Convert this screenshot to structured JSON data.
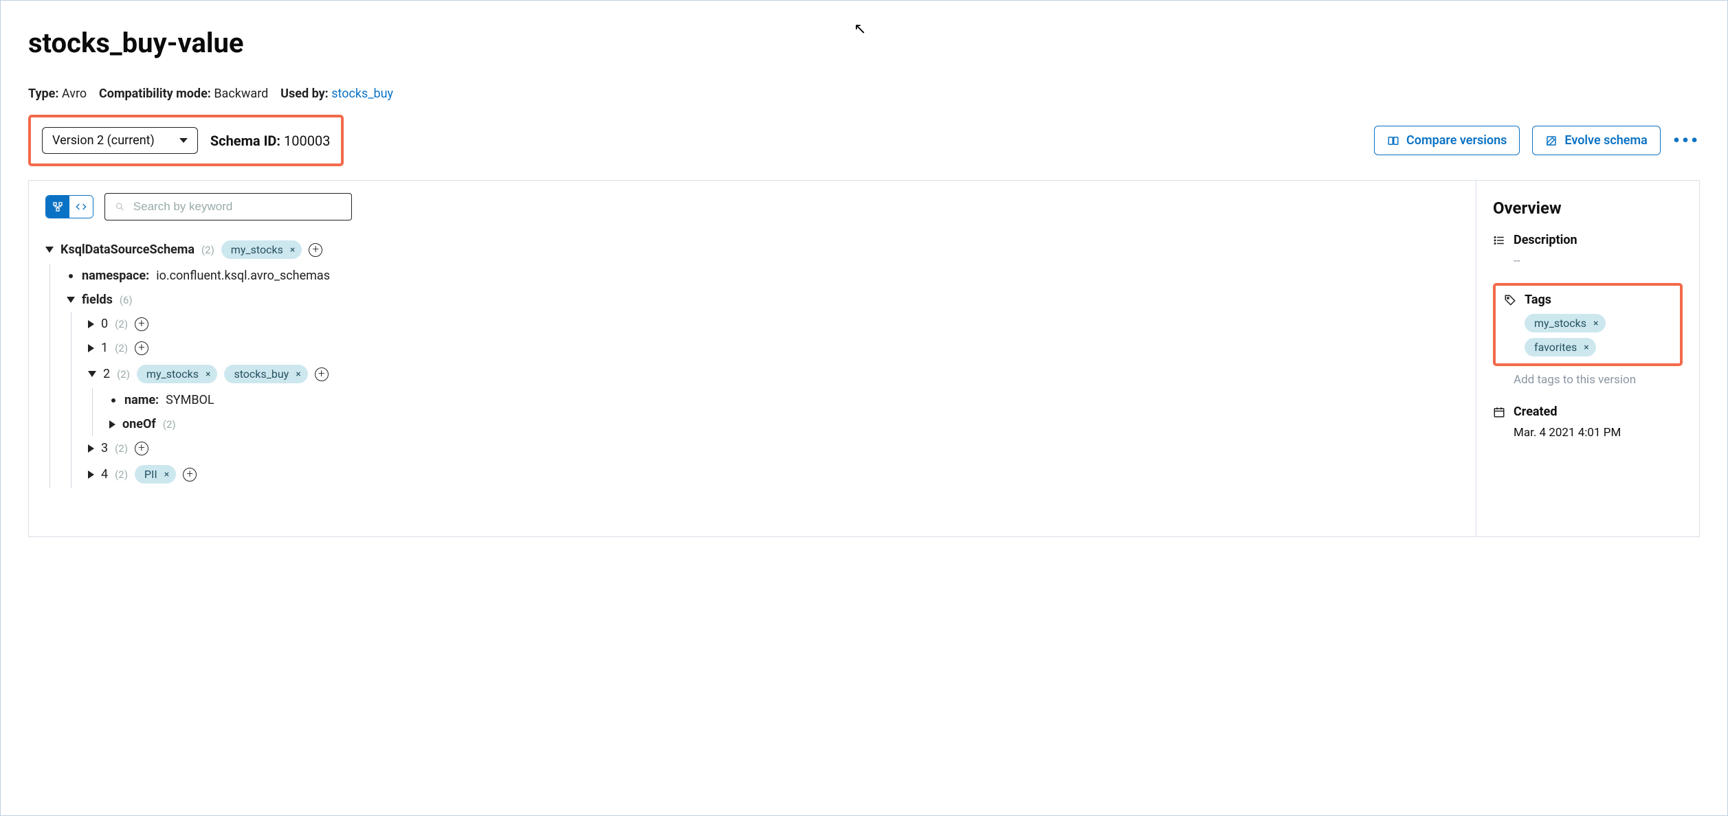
{
  "title": "stocks_buy-value",
  "meta": {
    "type_label": "Type:",
    "type_value": "Avro",
    "compat_label": "Compatibility mode:",
    "compat_value": "Backward",
    "usedby_label": "Used by:",
    "usedby_link": "stocks_buy"
  },
  "version": {
    "select_label": "Version 2 (current)",
    "schema_id_label": "Schema ID:",
    "schema_id_value": "100003"
  },
  "actions": {
    "compare": "Compare versions",
    "evolve": "Evolve schema"
  },
  "search": {
    "placeholder": "Search by keyword"
  },
  "tree": {
    "root": {
      "name": "KsqlDataSourceSchema",
      "count": "(2)",
      "tags": [
        "my_stocks"
      ]
    },
    "namespace": {
      "label": "namespace:",
      "value": "io.confluent.ksql.avro_schemas"
    },
    "fields": {
      "label": "fields",
      "count": "(6)",
      "rows": [
        {
          "name": "0",
          "count": "(2)",
          "tags": [],
          "expanded": false
        },
        {
          "name": "1",
          "count": "(2)",
          "tags": [],
          "expanded": false
        },
        {
          "name": "2",
          "count": "(2)",
          "tags": [
            "my_stocks",
            "stocks_buy"
          ],
          "expanded": true,
          "child_name_label": "name:",
          "child_name_value": "SYMBOL",
          "child_oneof_label": "oneOf",
          "child_oneof_count": "(2)"
        },
        {
          "name": "3",
          "count": "(2)",
          "tags": [],
          "expanded": false
        },
        {
          "name": "4",
          "count": "(2)",
          "tags": [
            "PII"
          ],
          "expanded": false
        }
      ]
    }
  },
  "overview": {
    "heading": "Overview",
    "description_label": "Description",
    "description_value": "--",
    "tags_label": "Tags",
    "tags": [
      "my_stocks",
      "favorites"
    ],
    "tags_hint": "Add tags to this version",
    "created_label": "Created",
    "created_value": "Mar. 4 2021 4:01 PM"
  }
}
